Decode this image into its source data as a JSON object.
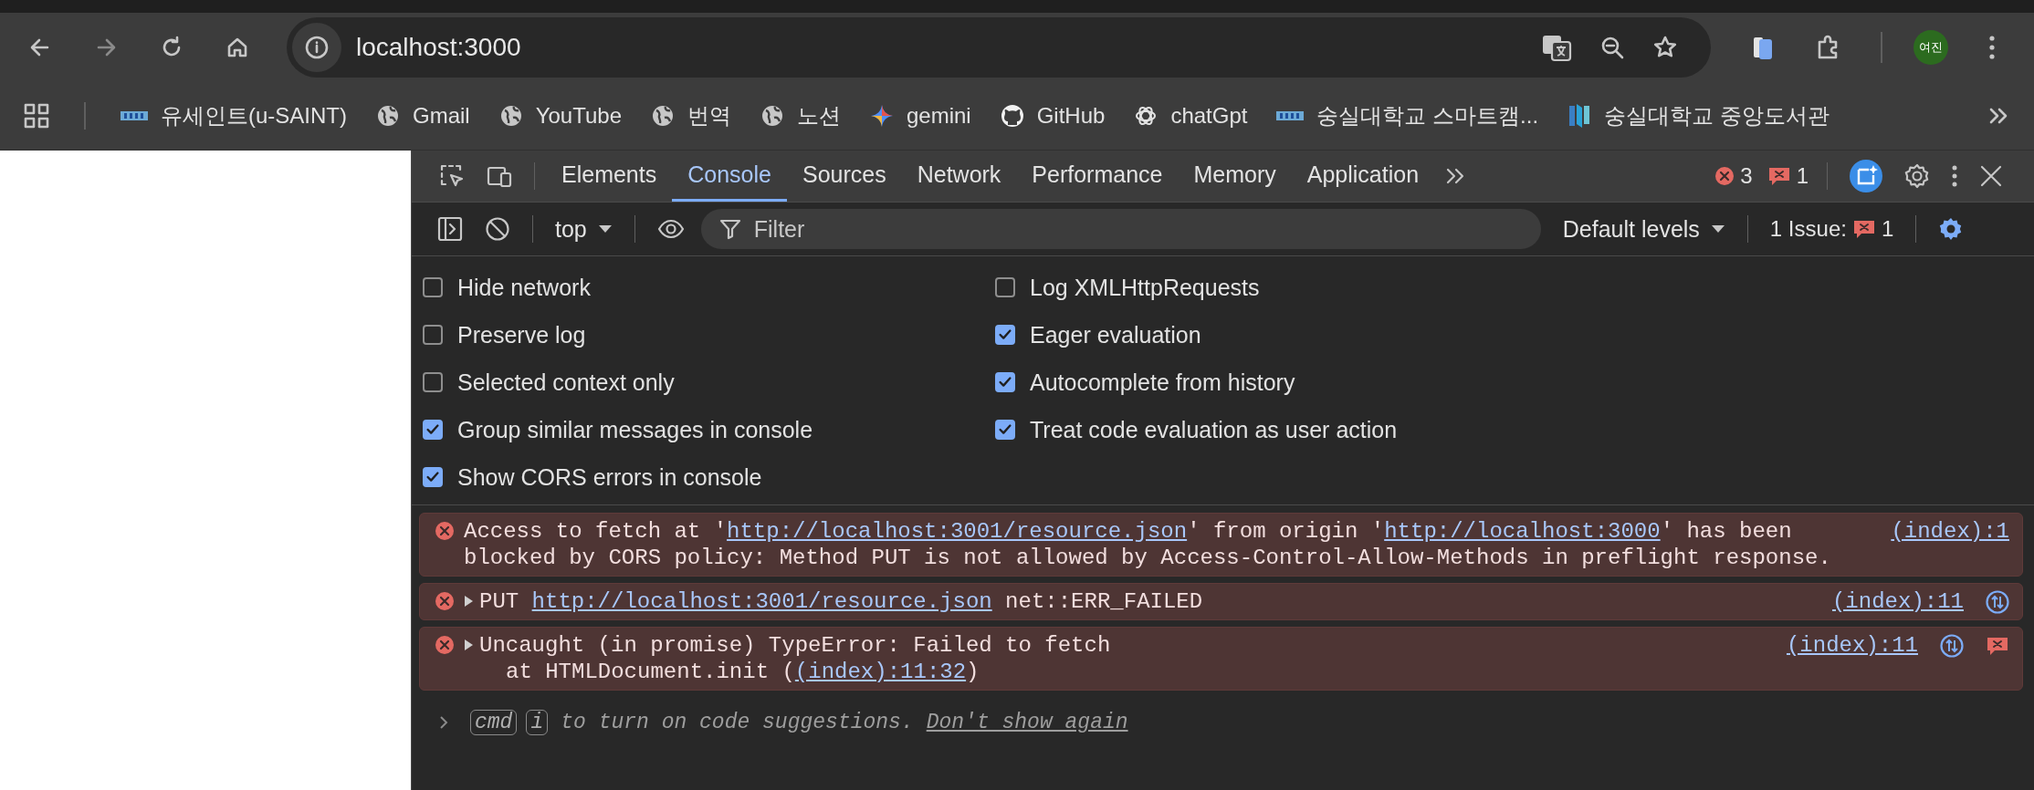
{
  "browser": {
    "address": "localhost:3000",
    "profile": "여진",
    "bookmarks": [
      {
        "label": "유세인트(u-SAINT)",
        "kind": "stripe"
      },
      {
        "label": "Gmail",
        "kind": "globe"
      },
      {
        "label": "YouTube",
        "kind": "globe"
      },
      {
        "label": "번역",
        "kind": "globe"
      },
      {
        "label": "노션",
        "kind": "globe"
      },
      {
        "label": "gemini",
        "kind": "sparkle"
      },
      {
        "label": "GitHub",
        "kind": "cat"
      },
      {
        "label": "chatGpt",
        "kind": "knot"
      },
      {
        "label": "숭실대학교 스마트캠...",
        "kind": "stripe"
      },
      {
        "label": "숭실대학교 중앙도서관",
        "kind": "library"
      }
    ]
  },
  "devtools": {
    "tabs": [
      {
        "label": "Elements",
        "selected": false
      },
      {
        "label": "Console",
        "selected": true
      },
      {
        "label": "Sources",
        "selected": false
      },
      {
        "label": "Network",
        "selected": false
      },
      {
        "label": "Performance",
        "selected": false
      },
      {
        "label": "Memory",
        "selected": false
      },
      {
        "label": "Application",
        "selected": false
      }
    ],
    "error_count": "3",
    "issue_count": "1",
    "console_toolbar": {
      "context": "top",
      "filter": {
        "placeholder": "Filter"
      },
      "levels": "Default levels",
      "issues_label": "1 Issue:",
      "issues_count": "1"
    },
    "settings": {
      "left": [
        {
          "label": "Hide network",
          "checked": false
        },
        {
          "label": "Preserve log",
          "checked": false
        },
        {
          "label": "Selected context only",
          "checked": false
        },
        {
          "label": "Group similar messages in console",
          "checked": true
        },
        {
          "label": "Show CORS errors in console",
          "checked": true
        }
      ],
      "right": [
        {
          "label": "Log XMLHttpRequests",
          "checked": false
        },
        {
          "label": "Eager evaluation",
          "checked": true
        },
        {
          "label": "Autocomplete from history",
          "checked": true
        },
        {
          "label": "Treat code evaluation as user action",
          "checked": true
        }
      ]
    },
    "messages": [
      {
        "expandable": false,
        "lines": [
          [
            {
              "kind": "text",
              "text": "Access to fetch at '"
            },
            {
              "kind": "link",
              "text": "http://localhost:3001/resource.json"
            },
            {
              "kind": "text",
              "text": "' from origin '"
            },
            {
              "kind": "link",
              "text": "http://localhost:3000"
            },
            {
              "kind": "text",
              "text": "' has been"
            }
          ],
          [
            {
              "kind": "text",
              "text": "blocked by CORS policy: Method PUT is not allowed by Access-Control-Allow-Methods in preflight response."
            }
          ]
        ],
        "source": "(index):1",
        "network_icon": false,
        "issue_icon": false
      },
      {
        "expandable": true,
        "lines": [
          [
            {
              "kind": "text",
              "text": "PUT "
            },
            {
              "kind": "link",
              "text": "http://localhost:3001/resource.json"
            },
            {
              "kind": "text",
              "text": " net::ERR_FAILED"
            }
          ]
        ],
        "source": "(index):11",
        "network_icon": true,
        "issue_icon": false
      },
      {
        "expandable": true,
        "lines": [
          [
            {
              "kind": "text",
              "text": "Uncaught (in promise) TypeError: Failed to fetch"
            }
          ]
        ],
        "stack": [
          [
            {
              "kind": "text",
              "text": "at HTMLDocument.init ("
            },
            {
              "kind": "link",
              "text": "(index):11:32"
            },
            {
              "kind": "text",
              "text": ")"
            }
          ]
        ],
        "source": "(index):11",
        "network_icon": true,
        "issue_icon": true
      }
    ],
    "prompt": {
      "keys": [
        "cmd",
        "i"
      ],
      "text": "to turn on code suggestions.",
      "link": "Don't show again"
    }
  }
}
